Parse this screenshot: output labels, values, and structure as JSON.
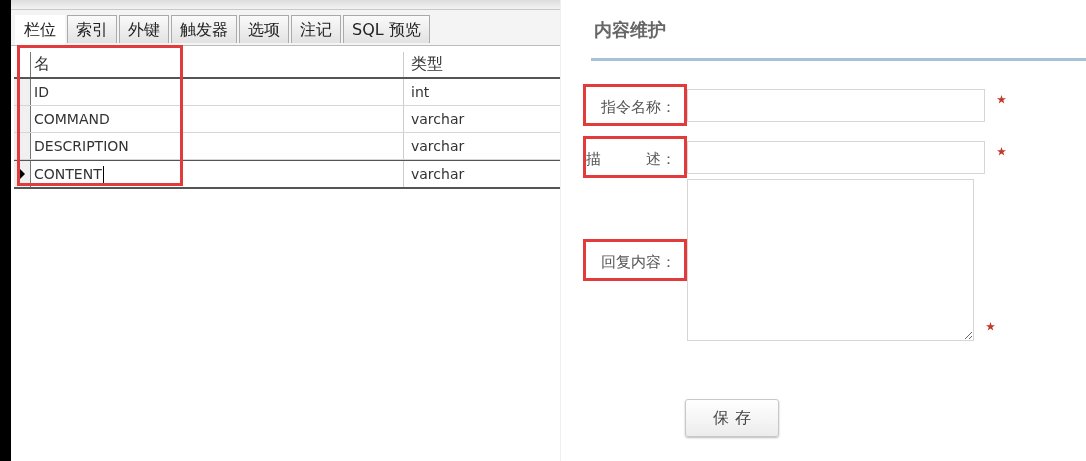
{
  "designer": {
    "tabs": [
      {
        "label": "栏位",
        "selected": true
      },
      {
        "label": "索引",
        "selected": false
      },
      {
        "label": "外键",
        "selected": false
      },
      {
        "label": "触发器",
        "selected": false
      },
      {
        "label": "选项",
        "selected": false
      },
      {
        "label": "注记",
        "selected": false
      },
      {
        "label": "SQL 预览",
        "selected": false
      }
    ],
    "table": {
      "columns": [
        "名",
        "类型"
      ],
      "name_column_highlighted": true,
      "rows": [
        {
          "name": "ID",
          "type": "int",
          "current": false
        },
        {
          "name": "COMMAND",
          "type": "varchar",
          "current": false
        },
        {
          "name": "DESCRIPTION",
          "type": "varchar",
          "current": false
        },
        {
          "name": "CONTENT",
          "type": "varchar",
          "current": true
        }
      ]
    }
  },
  "form": {
    "title": "内容维护",
    "fields": [
      {
        "kind": "input",
        "label": "指令名称：",
        "required": true,
        "highlighted": true
      },
      {
        "kind": "input",
        "label": "描　　　述：",
        "required": true,
        "highlighted": true
      },
      {
        "kind": "textarea",
        "label": "回复内容：",
        "required": true,
        "highlighted": true
      }
    ],
    "save_button": "保 存"
  }
}
